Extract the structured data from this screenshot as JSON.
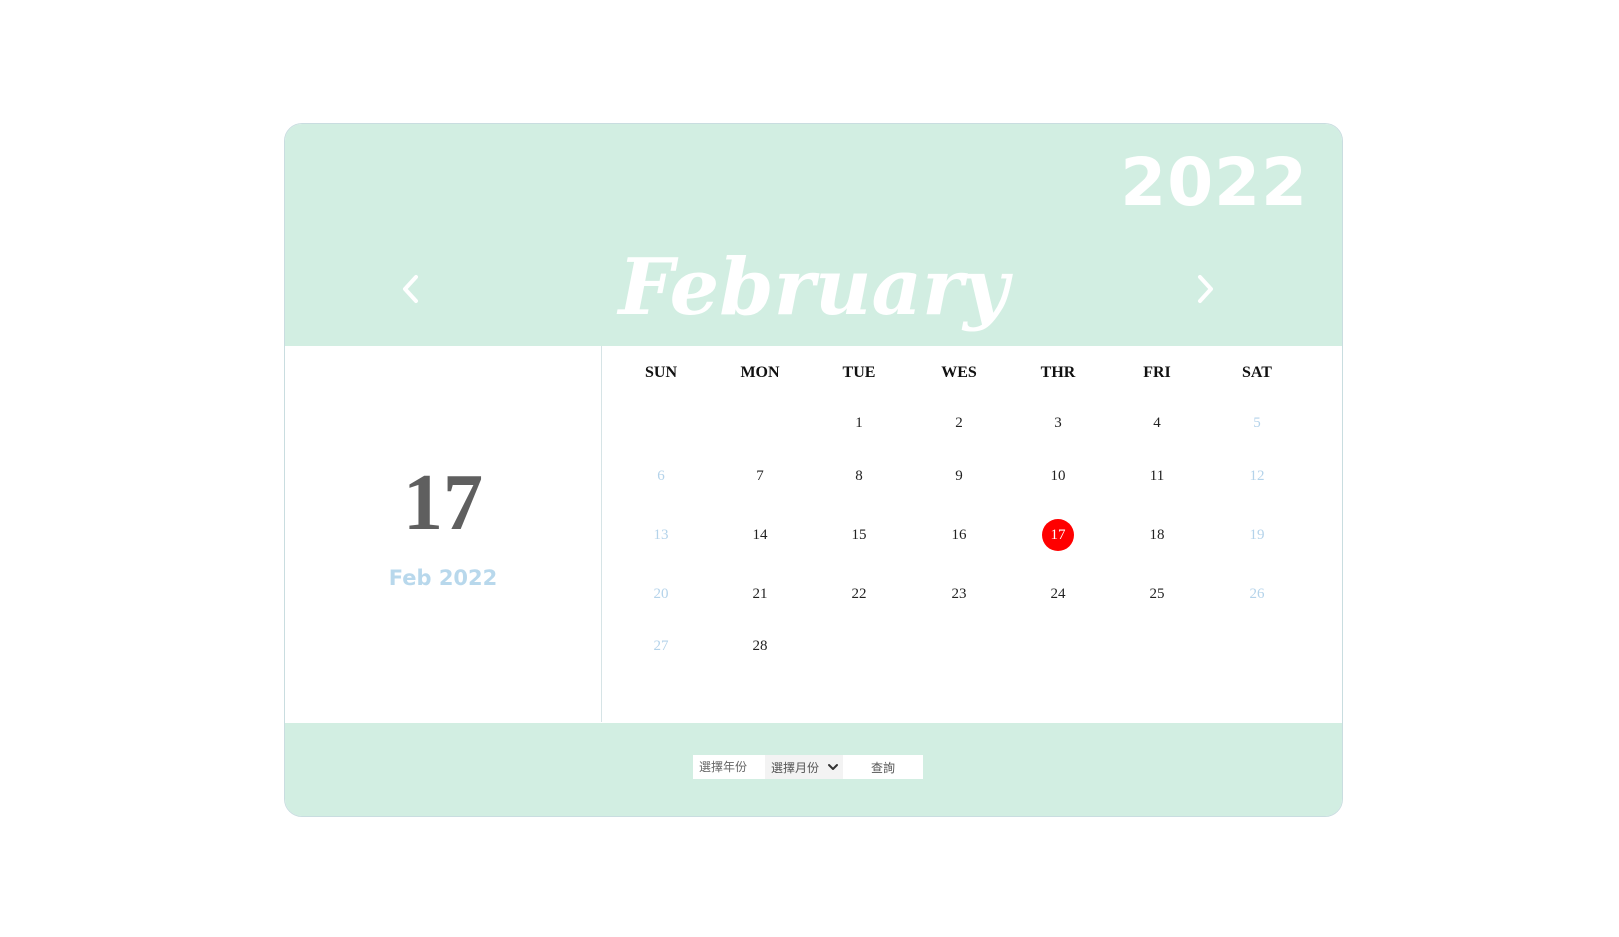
{
  "header": {
    "year": "2022",
    "month": "February"
  },
  "selected": {
    "day": "17",
    "label": "Feb 2022"
  },
  "weekdays": [
    "SUN",
    "MON",
    "TUE",
    "WES",
    "THR",
    "FRI",
    "SAT"
  ],
  "weeks": [
    [
      "",
      "",
      "1",
      "2",
      "3",
      "4",
      "5"
    ],
    [
      "6",
      "7",
      "8",
      "9",
      "10",
      "11",
      "12"
    ],
    [
      "13",
      "14",
      "15",
      "16",
      "17",
      "18",
      "19"
    ],
    [
      "20",
      "21",
      "22",
      "23",
      "24",
      "25",
      "26"
    ],
    [
      "27",
      "28",
      "",
      "",
      "",
      "",
      ""
    ]
  ],
  "today": "17",
  "footer": {
    "year_placeholder": "選擇年份",
    "month_select": "選擇月份",
    "query_button": "查詢"
  },
  "colors": {
    "header_bg": "#d2eee2",
    "weekend": "#b4d3ea",
    "today": "#ff0000"
  },
  "icons": {
    "prev": "chevron-left-icon",
    "next": "chevron-right-icon",
    "dropdown": "chevron-down-icon"
  }
}
